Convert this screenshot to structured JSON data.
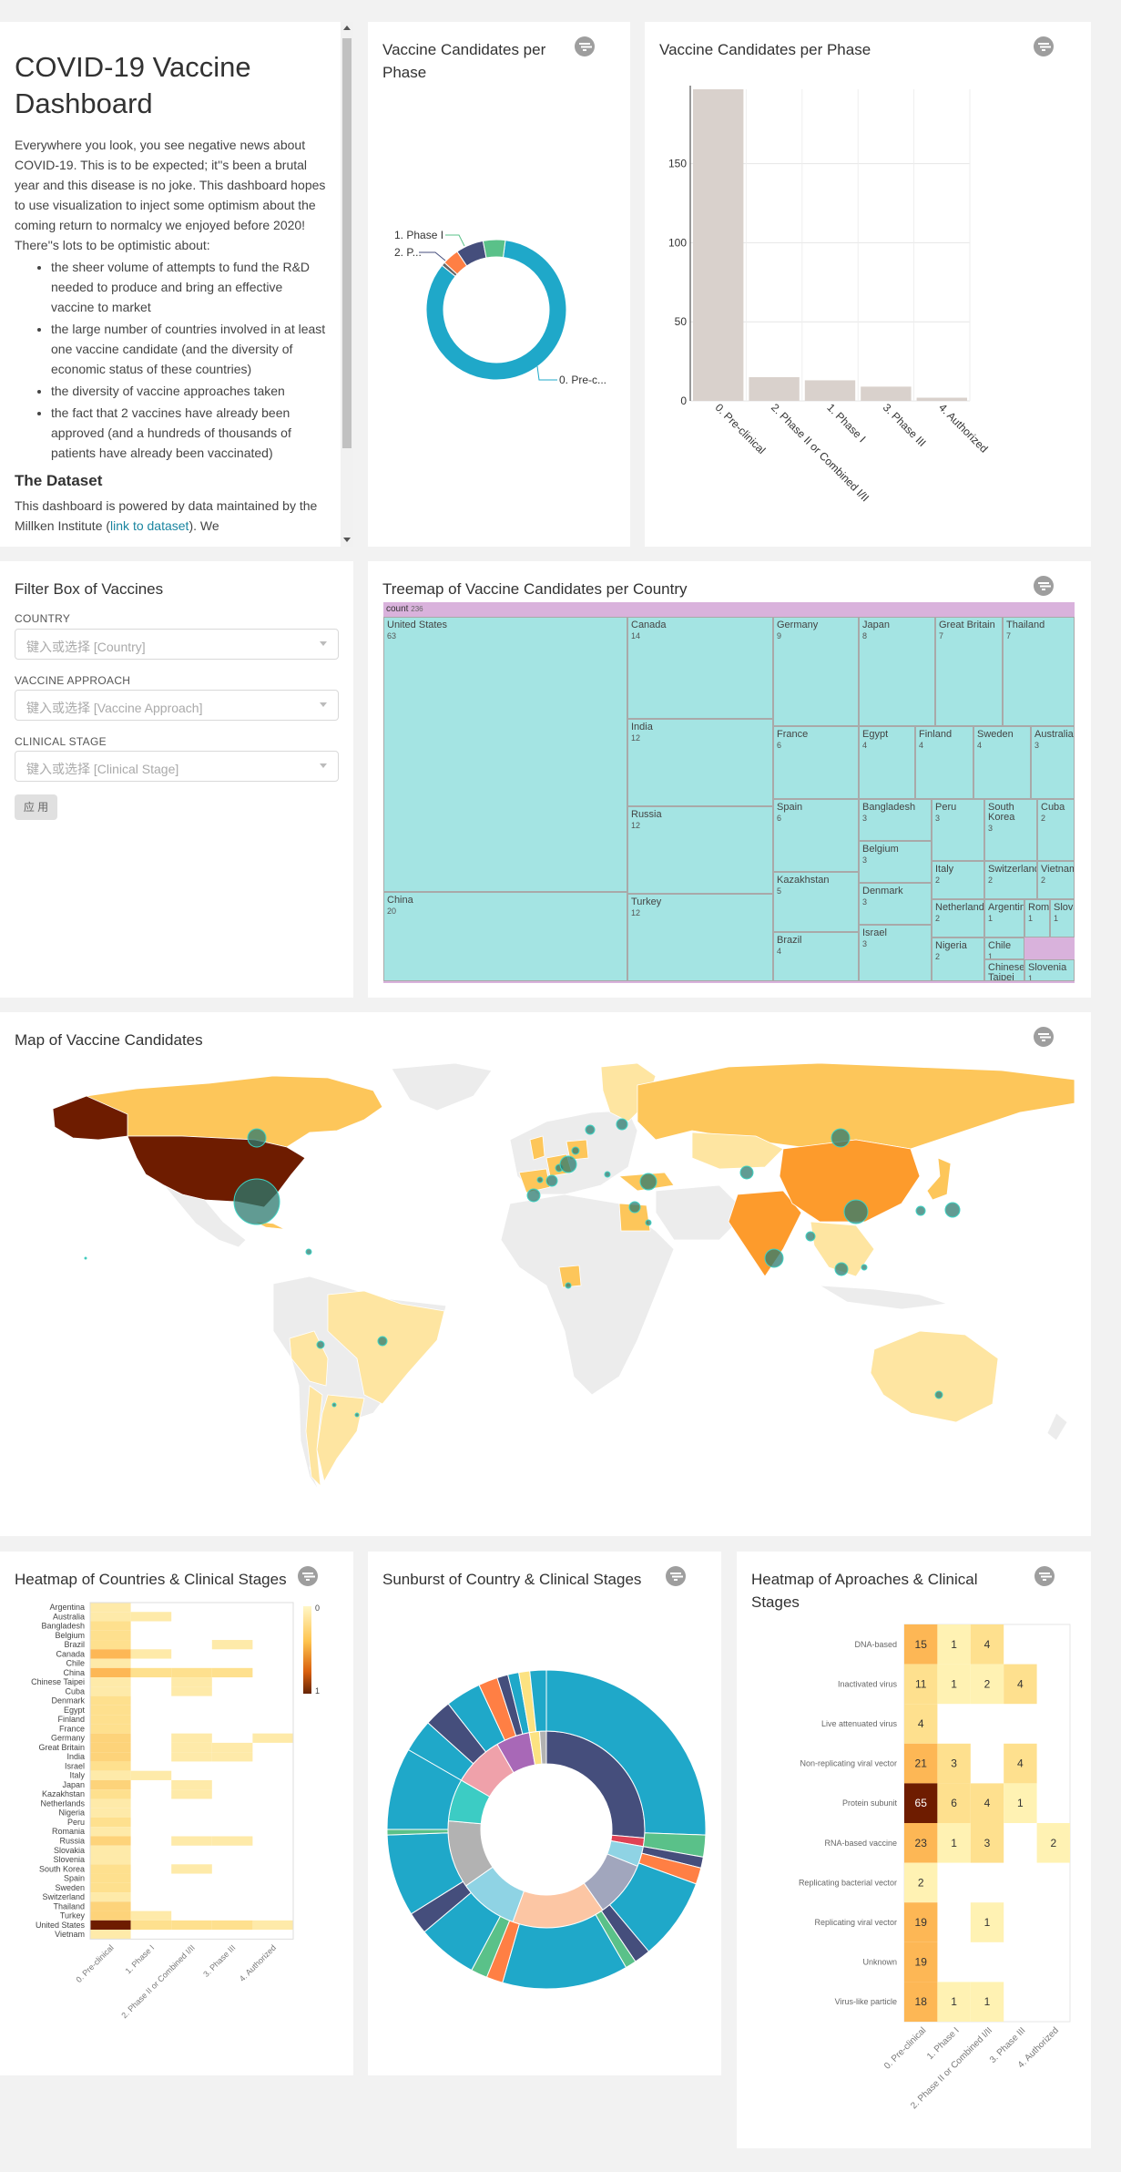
{
  "colors": {
    "page_bg": "#f2f2f2",
    "card_bg": "#ffffff",
    "donut_main": "#1fa8c9",
    "bar": "#d9d1cc",
    "treemap_fill": "#a4e4e3",
    "treemap_header": "#d9b2dc",
    "map_land_none": "#ececec",
    "map_high": "#6e1c00",
    "map_mid": "#fd9b2c",
    "map_low": "#fee5a1",
    "bubble": "#2c7a6f"
  },
  "markdown": {
    "title": "COVID-19 Vaccine Dashboard",
    "intro": "Everywhere you look, you see negative news about COVID-19. This is to be expected; it''s been a brutal year and this disease is no joke. This dashboard hopes to use visualization to inject some optimism about the coming return to normalcy we enjoyed before 2020! There''s lots to be optimistic about:",
    "bullets": [
      "the sheer volume of attempts to fund the R&D needed to produce and bring an effective vaccine to market",
      "the large number of countries involved in at least one vaccine candidate (and the diversity of economic status of these countries)",
      "the diversity of vaccine approaches taken",
      "the fact that 2 vaccines have already been approved (and a hundreds of thousands of patients have already been vaccinated)"
    ],
    "dataset_heading": "The Dataset",
    "dataset_text_before": "This dashboard is powered by data maintained by the Millken Institute (",
    "dataset_link": "link to dataset",
    "dataset_text_after": "). We"
  },
  "donut": {
    "title": "Vaccine Candidates per Phase",
    "labels": [
      "1. Phase I",
      "2. P...",
      "0. Pre-c..."
    ]
  },
  "bar_card": {
    "title": "Vaccine Candidates per Phase"
  },
  "filter_box": {
    "title": "Filter Box of Vaccines",
    "country_label": "COUNTRY",
    "country_placeholder": "键入或选择 [Country]",
    "approach_label": "VACCINE APPROACH",
    "approach_placeholder": "键入或选择 [Vaccine Approach]",
    "stage_label": "CLINICAL STAGE",
    "stage_placeholder": "键入或选择 [Clinical Stage]",
    "apply_label": "应 用"
  },
  "treemap": {
    "title": "Treemap of Vaccine Candidates per Country",
    "root_label": "count",
    "root_value": "236",
    "nodes": [
      {
        "name": "United States",
        "value": "63"
      },
      {
        "name": "China",
        "value": "20"
      },
      {
        "name": "Canada",
        "value": "14"
      },
      {
        "name": "India",
        "value": "12"
      },
      {
        "name": "Russia",
        "value": "12"
      },
      {
        "name": "Turkey",
        "value": "12"
      },
      {
        "name": "Germany",
        "value": "9"
      },
      {
        "name": "Japan",
        "value": "8"
      },
      {
        "name": "Great Britain",
        "value": "7"
      },
      {
        "name": "Thailand",
        "value": "7"
      },
      {
        "name": "France",
        "value": "6"
      },
      {
        "name": "Spain",
        "value": "6"
      },
      {
        "name": "Kazakhstan",
        "value": "5"
      },
      {
        "name": "Brazil",
        "value": "4"
      },
      {
        "name": "Egypt",
        "value": "4"
      },
      {
        "name": "Finland",
        "value": "4"
      },
      {
        "name": "Sweden",
        "value": "4"
      },
      {
        "name": "Australia",
        "value": "3"
      },
      {
        "name": "Bangladesh",
        "value": "3"
      },
      {
        "name": "Belgium",
        "value": "3"
      },
      {
        "name": "Denmark",
        "value": "3"
      },
      {
        "name": "Israel",
        "value": "3"
      },
      {
        "name": "Peru",
        "value": "3"
      },
      {
        "name": "South Korea",
        "value": "3"
      },
      {
        "name": "Cuba",
        "value": "2"
      },
      {
        "name": "Italy",
        "value": "2"
      },
      {
        "name": "Switzerland",
        "value": "2"
      },
      {
        "name": "Vietnam",
        "value": "2"
      },
      {
        "name": "Netherlands",
        "value": "2"
      },
      {
        "name": "Nigeria",
        "value": "2"
      },
      {
        "name": "Argentina",
        "value": "1"
      },
      {
        "name": "Romania",
        "value": "1"
      },
      {
        "name": "Slovakia",
        "value": "1"
      },
      {
        "name": "Chile",
        "value": "1"
      },
      {
        "name": "Chinese Taipei",
        "value": "1"
      },
      {
        "name": "Slovenia",
        "value": "1"
      }
    ]
  },
  "map_card": {
    "title": "Map of Vaccine Candidates"
  },
  "heatmap_countries": {
    "title": "Heatmap of Countries & Clinical Stages"
  },
  "sunburst": {
    "title": "Sunburst of Country & Clinical Stages"
  },
  "heatmap_approaches": {
    "title": "Heatmap of Aproaches & Clinical Stages"
  },
  "chart_data": [
    {
      "type": "pie",
      "title": "Vaccine Candidates per Phase",
      "categories": [
        "0. Pre-clinical",
        "1. Phase I",
        "2. Phase II or Combined I/II",
        "3. Phase III",
        "4. Authorized"
      ],
      "values": [
        197,
        12,
        15,
        9,
        2
      ],
      "colors": [
        "#1fa8c9",
        "#5ac189",
        "#454e7c",
        "#ff7f44",
        "#666666"
      ]
    },
    {
      "type": "bar",
      "title": "Vaccine Candidates per Phase",
      "categories": [
        "0. Pre-clinical",
        "2. Phase II or Combined I/II",
        "1. Phase I",
        "3. Phase III",
        "4. Authorized"
      ],
      "values": [
        197,
        15,
        13,
        9,
        2
      ],
      "ylim": [
        0,
        197
      ],
      "yticks": [
        0,
        50,
        100,
        150
      ],
      "grid": true
    },
    {
      "type": "heatmap",
      "title": "Heatmap of Countries & Clinical Stages",
      "x": [
        "0. Pre-clinical",
        "1. Phase I",
        "2. Phase II or Combined I/II",
        "3. Phase III",
        "4. Authorized"
      ],
      "y": [
        "Argentina",
        "Australia",
        "Bangladesh",
        "Belgium",
        "Brazil",
        "Canada",
        "Chile",
        "China",
        "Chinese Taipei",
        "Cuba",
        "Denmark",
        "Egypt",
        "Finland",
        "France",
        "Germany",
        "Great Britain",
        "India",
        "Israel",
        "Italy",
        "Japan",
        "Kazakhstan",
        "Netherlands",
        "Nigeria",
        "Peru",
        "Romania",
        "Russia",
        "Slovakia",
        "Slovenia",
        "South Korea",
        "Spain",
        "Sweden",
        "Switzerland",
        "Thailand",
        "Turkey",
        "United States",
        "Vietnam"
      ],
      "values": [
        [
          0.02,
          0,
          0,
          0,
          0
        ],
        [
          0.03,
          0.02,
          0,
          0,
          0
        ],
        [
          0.05,
          0,
          0,
          0,
          0
        ],
        [
          0.05,
          0,
          0,
          0,
          0
        ],
        [
          0.05,
          0,
          0,
          0.02,
          0
        ],
        [
          0.2,
          0.02,
          0,
          0,
          0
        ],
        [
          0.02,
          0,
          0,
          0,
          0
        ],
        [
          0.25,
          0.05,
          0.05,
          0.05,
          0
        ],
        [
          0.02,
          0,
          0.02,
          0,
          0
        ],
        [
          0.03,
          0,
          0.02,
          0,
          0
        ],
        [
          0.05,
          0,
          0,
          0,
          0
        ],
        [
          0.05,
          0,
          0,
          0,
          0
        ],
        [
          0.05,
          0,
          0,
          0,
          0
        ],
        [
          0.08,
          0,
          0,
          0,
          0
        ],
        [
          0.1,
          0,
          0.03,
          0,
          0.02
        ],
        [
          0.1,
          0,
          0.03,
          0.03,
          0
        ],
        [
          0.15,
          0,
          0.02,
          0.02,
          0
        ],
        [
          0.05,
          0,
          0,
          0,
          0
        ],
        [
          0.03,
          0.02,
          0,
          0,
          0
        ],
        [
          0.1,
          0,
          0.02,
          0,
          0
        ],
        [
          0.05,
          0,
          0.02,
          0,
          0
        ],
        [
          0.03,
          0,
          0,
          0,
          0
        ],
        [
          0.03,
          0,
          0,
          0,
          0
        ],
        [
          0.05,
          0,
          0,
          0,
          0
        ],
        [
          0.02,
          0,
          0,
          0,
          0
        ],
        [
          0.15,
          0,
          0.02,
          0.02,
          0
        ],
        [
          0.02,
          0,
          0,
          0,
          0
        ],
        [
          0.02,
          0,
          0,
          0,
          0
        ],
        [
          0.05,
          0,
          0.02,
          0,
          0
        ],
        [
          0.08,
          0,
          0,
          0,
          0
        ],
        [
          0.05,
          0,
          0,
          0,
          0
        ],
        [
          0.03,
          0,
          0,
          0,
          0
        ],
        [
          0.1,
          0,
          0,
          0,
          0
        ],
        [
          0.15,
          0.02,
          0,
          0,
          0
        ],
        [
          1,
          0.08,
          0.05,
          0.05,
          0.03
        ],
        [
          0.02,
          0,
          0,
          0,
          0
        ]
      ],
      "legend_range": [
        0,
        1
      ]
    },
    {
      "type": "heatmap",
      "title": "Heatmap of Aproaches & Clinical Stages",
      "x": [
        "0. Pre-clinical",
        "1. Phase I",
        "2. Phase II or Combined I/II",
        "3. Phase III",
        "4. Authorized"
      ],
      "y": [
        "DNA-based",
        "Inactivated virus",
        "Live attenuated virus",
        "Non-replicating viral vector",
        "Protein subunit",
        "RNA-based vaccine",
        "Replicating bacterial vector",
        "Replicating viral vector",
        "Unknown",
        "Virus-like particle"
      ],
      "values": [
        [
          15,
          1,
          4,
          null,
          null
        ],
        [
          11,
          1,
          2,
          4,
          null
        ],
        [
          4,
          null,
          null,
          null,
          null
        ],
        [
          21,
          3,
          null,
          4,
          null
        ],
        [
          65,
          6,
          4,
          1,
          null
        ],
        [
          23,
          1,
          3,
          null,
          2
        ],
        [
          2,
          null,
          null,
          null,
          null
        ],
        [
          19,
          null,
          1,
          null,
          null
        ],
        [
          19,
          null,
          null,
          null,
          null
        ],
        [
          18,
          1,
          1,
          null,
          null
        ]
      ]
    }
  ]
}
